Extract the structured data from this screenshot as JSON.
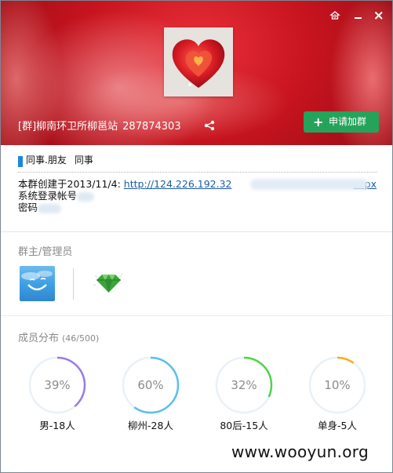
{
  "window": {
    "skin_icon": "skin-icon",
    "minimize_icon": "minimize-icon",
    "close_icon": "close-icon"
  },
  "header": {
    "group_name": "[群]柳南环卫所柳邕站",
    "group_id": "287874303",
    "share_icon": "share-icon",
    "join_button_label": "申请加群",
    "join_button_color": "#25a35a"
  },
  "tags": [
    "同事.朋友",
    "同事"
  ],
  "intro": {
    "line1_prefix": "本群创建于2013/11/4:",
    "line1_link": "http://124.226.192.32",
    "line1_link_tail": "aspx",
    "line2": "系统登录帐号",
    "line3": "密码"
  },
  "admins": {
    "title": "群主/管理员"
  },
  "members": {
    "title": "成员分布",
    "count": "(46/500)",
    "stats": [
      {
        "percent": 39,
        "text": "39%",
        "label": "男-18人",
        "color": "#9a7be8"
      },
      {
        "percent": 60,
        "text": "60%",
        "label": "柳州-28人",
        "color": "#5bbfeb"
      },
      {
        "percent": 32,
        "text": "32%",
        "label": "80后-15人",
        "color": "#4fd44a"
      },
      {
        "percent": 10,
        "text": "10%",
        "label": "单身-5人",
        "color": "#f0b11a"
      }
    ]
  },
  "watermark": "www.wooyun.org"
}
